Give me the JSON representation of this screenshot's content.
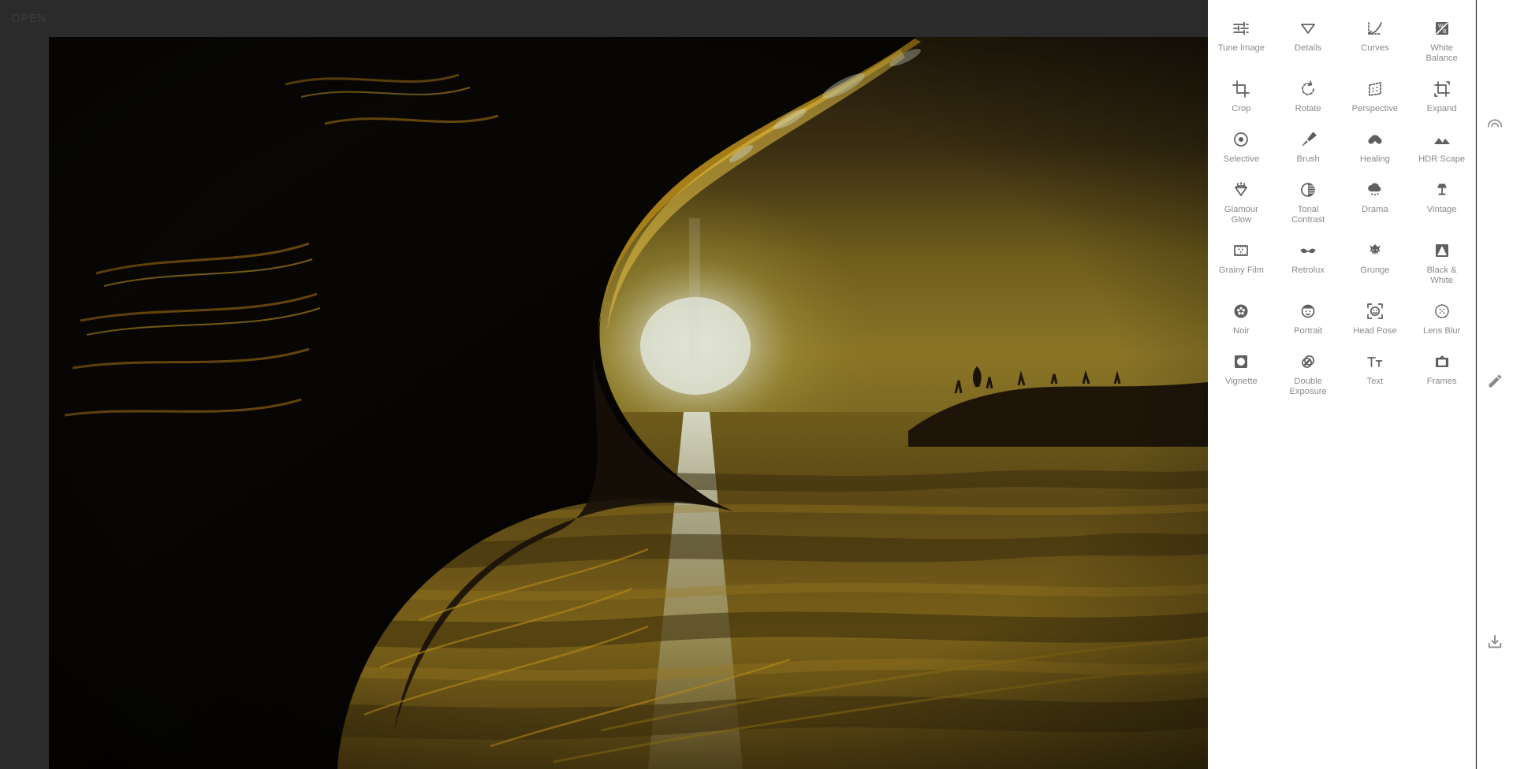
{
  "app": {
    "name": "Snapseed Photo Editor",
    "background_color": "#2b2b2b",
    "panel_color": "#ffffff"
  },
  "topbar": {
    "open_label": "OPEN"
  },
  "photo": {
    "description": "Dark sunset seascape with a large breaking wave silhouetted against a golden sky, sun low on the horizon reflecting on the ocean, headland cliff at right",
    "colors": {
      "sky_top": "#3b3018",
      "sky_glow": "#8e7a2c",
      "sun_core": "#cfd3cc",
      "wave_dark": "#0a0805",
      "wave_highlight": "#c79a1b",
      "water": "#6b5618",
      "headland": "#241a0e"
    }
  },
  "tool_panel": {
    "tools": [
      {
        "label": "Tune Image",
        "icon": "sliders-icon",
        "name": "tool-tune-image"
      },
      {
        "label": "Details",
        "icon": "triangle-down-icon",
        "name": "tool-details"
      },
      {
        "label": "Curves",
        "icon": "curves-icon",
        "name": "tool-curves"
      },
      {
        "label": "White\nBalance",
        "icon": "white-balance-icon",
        "name": "tool-white-balance"
      },
      {
        "label": "Crop",
        "icon": "crop-icon",
        "name": "tool-crop"
      },
      {
        "label": "Rotate",
        "icon": "rotate-icon",
        "name": "tool-rotate"
      },
      {
        "label": "Perspective",
        "icon": "perspective-icon",
        "name": "tool-perspective"
      },
      {
        "label": "Expand",
        "icon": "expand-icon",
        "name": "tool-expand"
      },
      {
        "label": "Selective",
        "icon": "selective-icon",
        "name": "tool-selective"
      },
      {
        "label": "Brush",
        "icon": "brush-icon",
        "name": "tool-brush"
      },
      {
        "label": "Healing",
        "icon": "healing-icon",
        "name": "tool-healing"
      },
      {
        "label": "HDR Scape",
        "icon": "mountains-icon",
        "name": "tool-hdr-scape"
      },
      {
        "label": "Glamour\nGlow",
        "icon": "glamour-glow-icon",
        "name": "tool-glamour-glow"
      },
      {
        "label": "Tonal\nContrast",
        "icon": "tonal-contrast-icon",
        "name": "tool-tonal-contrast"
      },
      {
        "label": "Drama",
        "icon": "cloud-rain-icon",
        "name": "tool-drama"
      },
      {
        "label": "Vintage",
        "icon": "lamp-icon",
        "name": "tool-vintage"
      },
      {
        "label": "Grainy Film",
        "icon": "grainy-film-icon",
        "name": "tool-grainy-film"
      },
      {
        "label": "Retrolux",
        "icon": "moustache-icon",
        "name": "tool-retrolux"
      },
      {
        "label": "Grunge",
        "icon": "grunge-icon",
        "name": "tool-grunge"
      },
      {
        "label": "Black &\nWhite",
        "icon": "black-white-icon",
        "name": "tool-black-white"
      },
      {
        "label": "Noir",
        "icon": "film-reel-icon",
        "name": "tool-noir"
      },
      {
        "label": "Portrait",
        "icon": "face-icon",
        "name": "tool-portrait"
      },
      {
        "label": "Head Pose",
        "icon": "head-pose-icon",
        "name": "tool-head-pose"
      },
      {
        "label": "Lens Blur",
        "icon": "lens-blur-icon",
        "name": "tool-lens-blur"
      },
      {
        "label": "Vignette",
        "icon": "vignette-icon",
        "name": "tool-vignette"
      },
      {
        "label": "Double\nExposure",
        "icon": "double-exposure-icon",
        "name": "tool-double-exposure"
      },
      {
        "label": "Text",
        "icon": "text-icon",
        "name": "tool-text"
      },
      {
        "label": "Frames",
        "icon": "frames-icon",
        "name": "tool-frames"
      }
    ]
  },
  "right_rail": {
    "buttons": [
      {
        "name": "rail-looks-button",
        "icon": "arc-icon"
      },
      {
        "name": "rail-tools-button",
        "icon": "pencil-icon"
      },
      {
        "name": "rail-export-button",
        "icon": "download-icon"
      }
    ]
  }
}
